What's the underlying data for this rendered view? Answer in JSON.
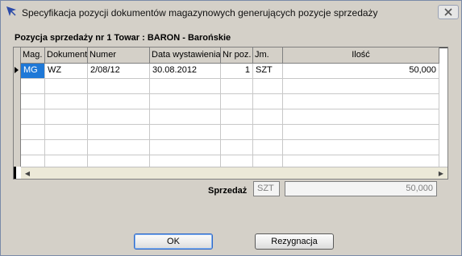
{
  "window": {
    "title": "Specyfikacja pozycji dokumentów magazynowych generujących pozycje sprzedaży"
  },
  "header": {
    "text": "Pozycja sprzedaży nr 1    Towar : BARON - Barońskie"
  },
  "table": {
    "columns": [
      "Mag.",
      "Dokument",
      "Numer",
      "Data wystawienia",
      "Nr poz.",
      "Jm.",
      "Ilość"
    ],
    "rows": [
      {
        "mag": "MG",
        "dokument": "WZ",
        "numer": "2/08/12",
        "data": "30.08.2012",
        "nrpoz": "1",
        "jm": "SZT",
        "ilosc": "50,000"
      }
    ]
  },
  "summary": {
    "label": "Sprzedaż",
    "unit": "SZT",
    "value": "50,000"
  },
  "buttons": {
    "ok": "OK",
    "cancel": "Rezygnacja"
  },
  "colors": {
    "selection": "#1e78d7",
    "background": "#d4d0c8"
  }
}
